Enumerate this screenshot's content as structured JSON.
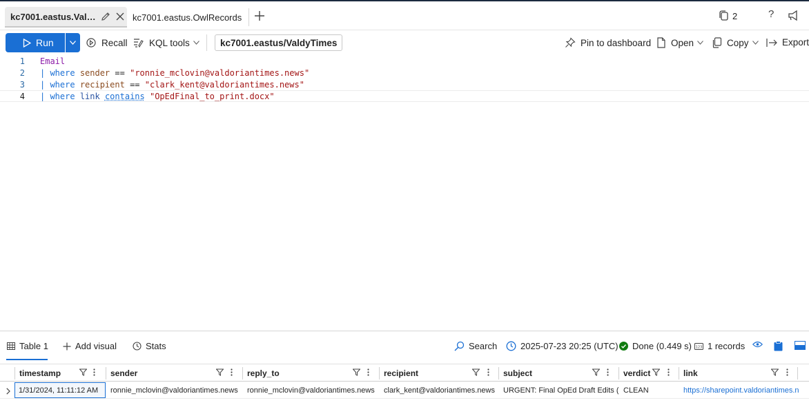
{
  "tabs": [
    {
      "label": "kc7001.eastus.Valdy..."
    },
    {
      "label": "kc7001.eastus.OwlRecords"
    }
  ],
  "header": {
    "copies_count": "2",
    "help_label": "?"
  },
  "toolbar": {
    "run_label": "Run",
    "recall_label": "Recall",
    "kql_tools_label": "KQL tools",
    "database": "kc7001.eastus/ValdyTimes",
    "pin_label": "Pin to dashboard",
    "open_label": "Open",
    "copy_label": "Copy",
    "export_label": "Export"
  },
  "editor": {
    "lines": [
      {
        "num": "1",
        "table": "Email"
      },
      {
        "num": "2",
        "pipe": "| ",
        "kw": "where",
        "col": "sender",
        "op": "==",
        "str": "\"ronnie_mclovin@valdoriantimes.news\""
      },
      {
        "num": "3",
        "pipe": "| ",
        "kw": "where",
        "col": "recipient",
        "op": "==",
        "str": "\"clark_kent@valdoriantimes.news\""
      },
      {
        "num": "4",
        "pipe": "| ",
        "kw": "where",
        "col": "link",
        "op": "contains",
        "str": "\"OpEdFinal_to_print.docx\""
      }
    ]
  },
  "results": {
    "table_tab_label": "Table 1",
    "add_visual_label": "Add visual",
    "stats_label": "Stats",
    "search_label": "Search",
    "timestamp": "2025-07-23 20:25 (UTC)",
    "status": "Done (0.449 s)",
    "records": "1 records",
    "colors": {
      "accent": "#1a6fd4",
      "success": "#107c10"
    }
  },
  "table": {
    "columns": [
      "timestamp",
      "sender",
      "reply_to",
      "recipient",
      "subject",
      "verdict",
      "link"
    ],
    "rows": [
      [
        "1/31/2024, 11:11:12 AM",
        "ronnie_mclovin@valdoriantimes.news",
        "ronnie_mclovin@valdoriantimes.news",
        "clark_kent@valdoriantimes.news",
        "URGENT: Final OpEd Draft Edits (Pi",
        "CLEAN",
        "https://sharepoint.valdoriantimes.n"
      ]
    ]
  }
}
